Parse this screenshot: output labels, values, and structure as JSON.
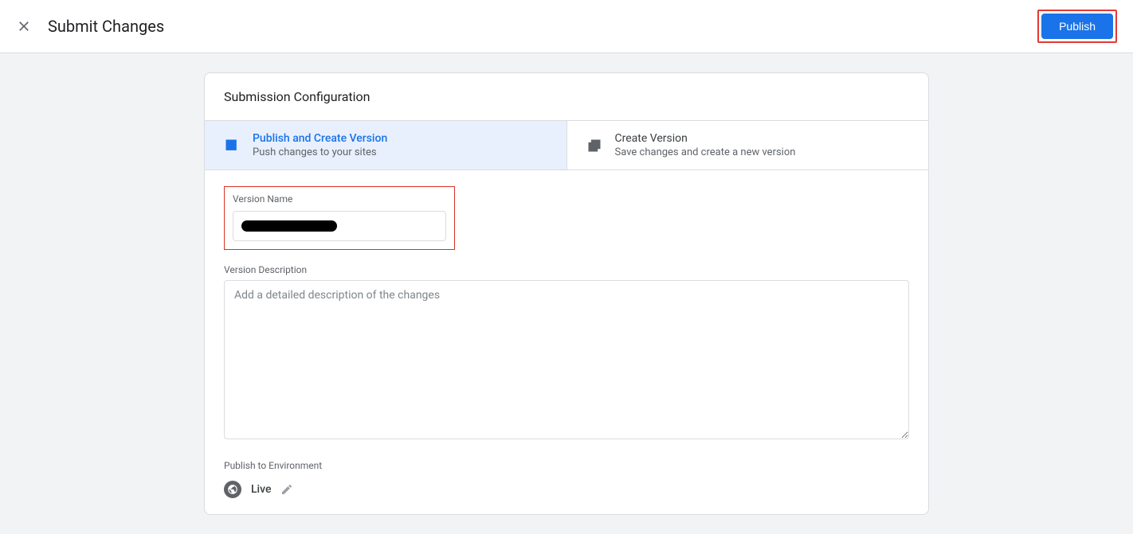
{
  "header": {
    "title": "Submit Changes",
    "publish_label": "Publish"
  },
  "section": {
    "title": "Submission Configuration"
  },
  "tabs": {
    "publish_create": {
      "title": "Publish and Create Version",
      "subtitle": "Push changes to your sites"
    },
    "create_version": {
      "title": "Create Version",
      "subtitle": "Save changes and create a new version"
    }
  },
  "form": {
    "version_name_label": "Version Name",
    "version_name_value": "",
    "version_desc_label": "Version Description",
    "version_desc_placeholder": "Add a detailed description of the changes",
    "publish_env_label": "Publish to Environment",
    "env_name": "Live"
  }
}
